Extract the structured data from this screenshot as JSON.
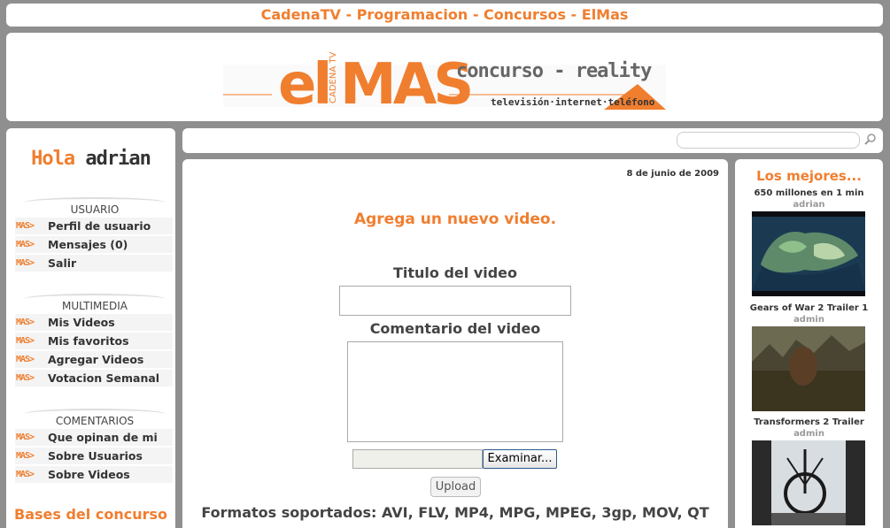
{
  "topbar": {
    "links": [
      "CadenaTV",
      "Programacion",
      "Concursos",
      "ElMas"
    ],
    "separator": " - "
  },
  "logo": {
    "brand_el": "el",
    "brand_cadena": "CADENA TV",
    "brand_mas": "MAS",
    "subtitle": "concurso - reality",
    "tagline": "televisión·internet·teléfono"
  },
  "sidebar": {
    "greeting": "Hola",
    "username": "adrian",
    "bullet": "MAS>",
    "sections": [
      {
        "title": "USUARIO",
        "items": [
          "Perfil de usuario",
          "Mensajes (0)",
          "Salir"
        ]
      },
      {
        "title": "MULTIMEDIA",
        "items": [
          "Mis Videos",
          "Mis favoritos",
          "Agregar Videos",
          "Votacion Semanal"
        ]
      },
      {
        "title": "COMENTARIOS",
        "items": [
          "Que opinan de mi",
          "Sobre Usuarios",
          "Sobre Videos"
        ]
      }
    ],
    "bases": "Bases del concurso"
  },
  "search": {
    "placeholder": ""
  },
  "main": {
    "date": "8 de junio de 2009",
    "title": "Agrega un nuevo video.",
    "video_title_label": "Titulo del video",
    "comment_label": "Comentario del video",
    "browse_label": "Examinar...",
    "upload_label": "Upload",
    "formats": "Formatos soportados: AVI, FLV, MP4, MPG, MPEG, 3gp, MOV, QT"
  },
  "best": {
    "title": "Los mejores...",
    "videos": [
      {
        "title": "650 millones en 1 min",
        "user": "adrian"
      },
      {
        "title": "Gears of War 2 Trailer 1",
        "user": "admin"
      },
      {
        "title": "Transformers 2 Trailer",
        "user": "admin"
      }
    ]
  },
  "colors": {
    "accent": "#f07e2f",
    "text": "#333333",
    "background": "#8f8f8f"
  }
}
